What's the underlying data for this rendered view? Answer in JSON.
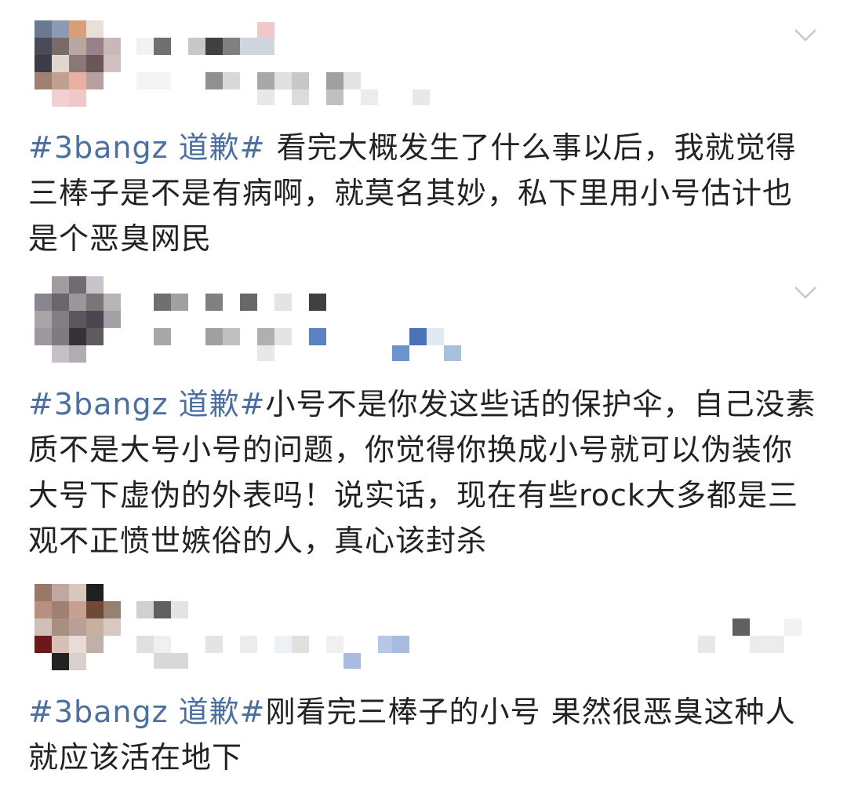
{
  "colors": {
    "text": "#222222",
    "hashtag": "#4a6fa0",
    "chevron": "#c8c8c8",
    "background": "#ffffff"
  },
  "posts": [
    {
      "hashtag": "#3bangz 道歉#",
      "text": "看完大概发生了什么事以后，我就觉得三棒子是不是有病啊，就莫名其妙，私下里用小号估计也是个恶臭网民",
      "menu_icon": "chevron-down-icon"
    },
    {
      "hashtag": "#3bangz 道歉#",
      "text": "小号不是你发这些话的保护伞，自己没素质不是大号小号的问题，你觉得你换成小号就可以伪装你大号下虚伪的外表吗！说实话，现在有些rock大多都是三观不正愤世嫉俗的人，真心该封杀",
      "menu_icon": "chevron-down-icon"
    },
    {
      "hashtag": "#3bangz 道歉#",
      "text": "刚看完三棒子的小号 果然很恶臭这种人就应该活在地下",
      "menu_icon": null
    }
  ]
}
